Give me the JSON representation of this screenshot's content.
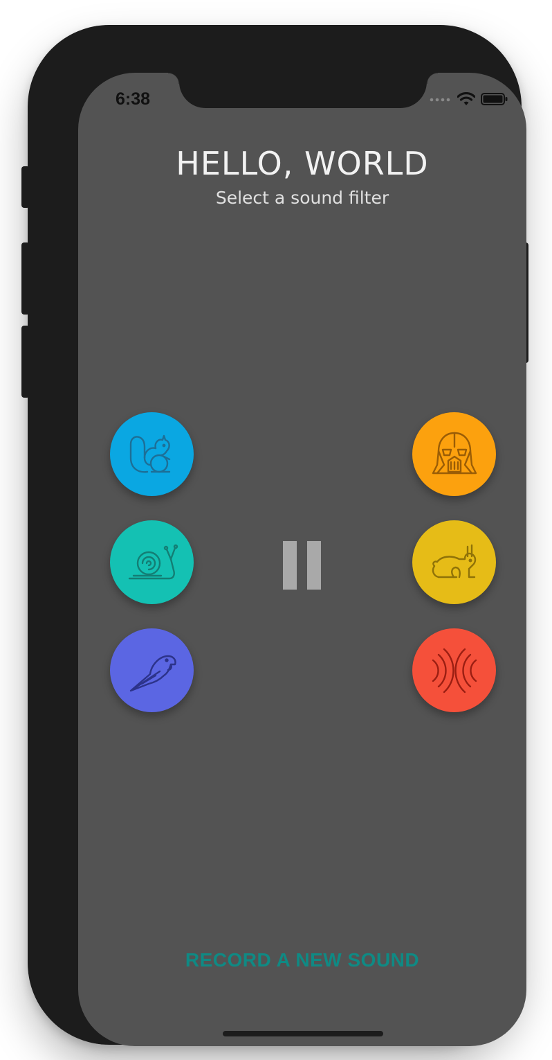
{
  "status_bar": {
    "time": "6:38",
    "icons": [
      "signal-dots-icon",
      "wifi-icon",
      "battery-icon"
    ]
  },
  "header": {
    "title": "HELLO, WORLD",
    "subtitle": "Select a sound filter"
  },
  "filters": [
    {
      "id": "chipmunk",
      "icon": "squirrel-icon",
      "color": "#0aa7e2"
    },
    {
      "id": "slow",
      "icon": "snail-icon",
      "color": "#14c1b3"
    },
    {
      "id": "parrot",
      "icon": "parrot-icon",
      "color": "#5b66e3"
    },
    {
      "id": "darth-vader",
      "icon": "darth-vader-helmet-icon",
      "color": "#fca10e"
    },
    {
      "id": "fast",
      "icon": "rabbit-icon",
      "color": "#e6bc17"
    },
    {
      "id": "echo",
      "icon": "echo-waves-icon",
      "color": "#f5503a"
    }
  ],
  "playback": {
    "state_icon": "pause-icon"
  },
  "footer": {
    "record_label": "RECORD A NEW SOUND",
    "record_color": "#0f8a84"
  },
  "colors": {
    "screen_background": "#535353",
    "device_frame": "#1c1c1c"
  }
}
